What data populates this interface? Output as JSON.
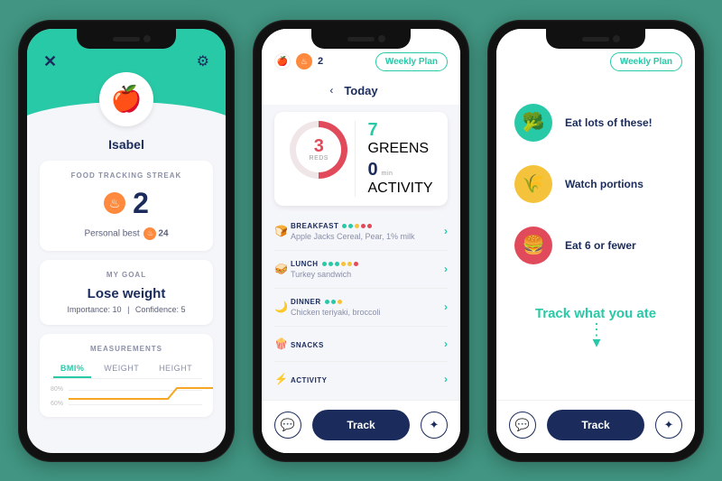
{
  "screen1": {
    "user_name": "Isabel",
    "card_streak_title": "FOOD TRACKING STREAK",
    "streak_value": "2",
    "personal_best_label": "Personal best",
    "personal_best_value": "24",
    "goal_section_title": "MY GOAL",
    "goal_text": "Lose weight",
    "importance_label": "Importance: 10",
    "confidence_label": "Confidence: 5",
    "measurements_title": "MEASUREMENTS",
    "tab_bmi": "BMI%",
    "tab_weight": "WEIGHT",
    "tab_height": "HEIGHT",
    "chart_y1": "80%",
    "chart_y2": "60%"
  },
  "screen2": {
    "streak_badge": "2",
    "weekly_plan": "Weekly Plan",
    "date_label": "Today",
    "reds_value": "3",
    "reds_label": "REDS",
    "greens_value": "7",
    "greens_label": "GREENS",
    "activity_value": "0",
    "activity_unit": "min",
    "activity_label": "ACTIVITY",
    "meals": {
      "breakfast": {
        "name": "BREAKFAST",
        "desc": "Apple Jacks Cereal, Pear, 1% milk"
      },
      "lunch": {
        "name": "LUNCH",
        "desc": "Turkey sandwich"
      },
      "dinner": {
        "name": "DINNER",
        "desc": "Chicken teriyaki, broccoli"
      },
      "snacks": {
        "name": "SNACKS"
      },
      "activity": {
        "name": "ACTIVITY"
      }
    },
    "track_button": "Track"
  },
  "screen3": {
    "weekly_plan": "Weekly Plan",
    "tip_green": "Eat lots of these!",
    "tip_yellow": "Watch portions",
    "tip_red": "Eat 6 or fewer",
    "cta": "Track what you ate",
    "track_button": "Track"
  }
}
